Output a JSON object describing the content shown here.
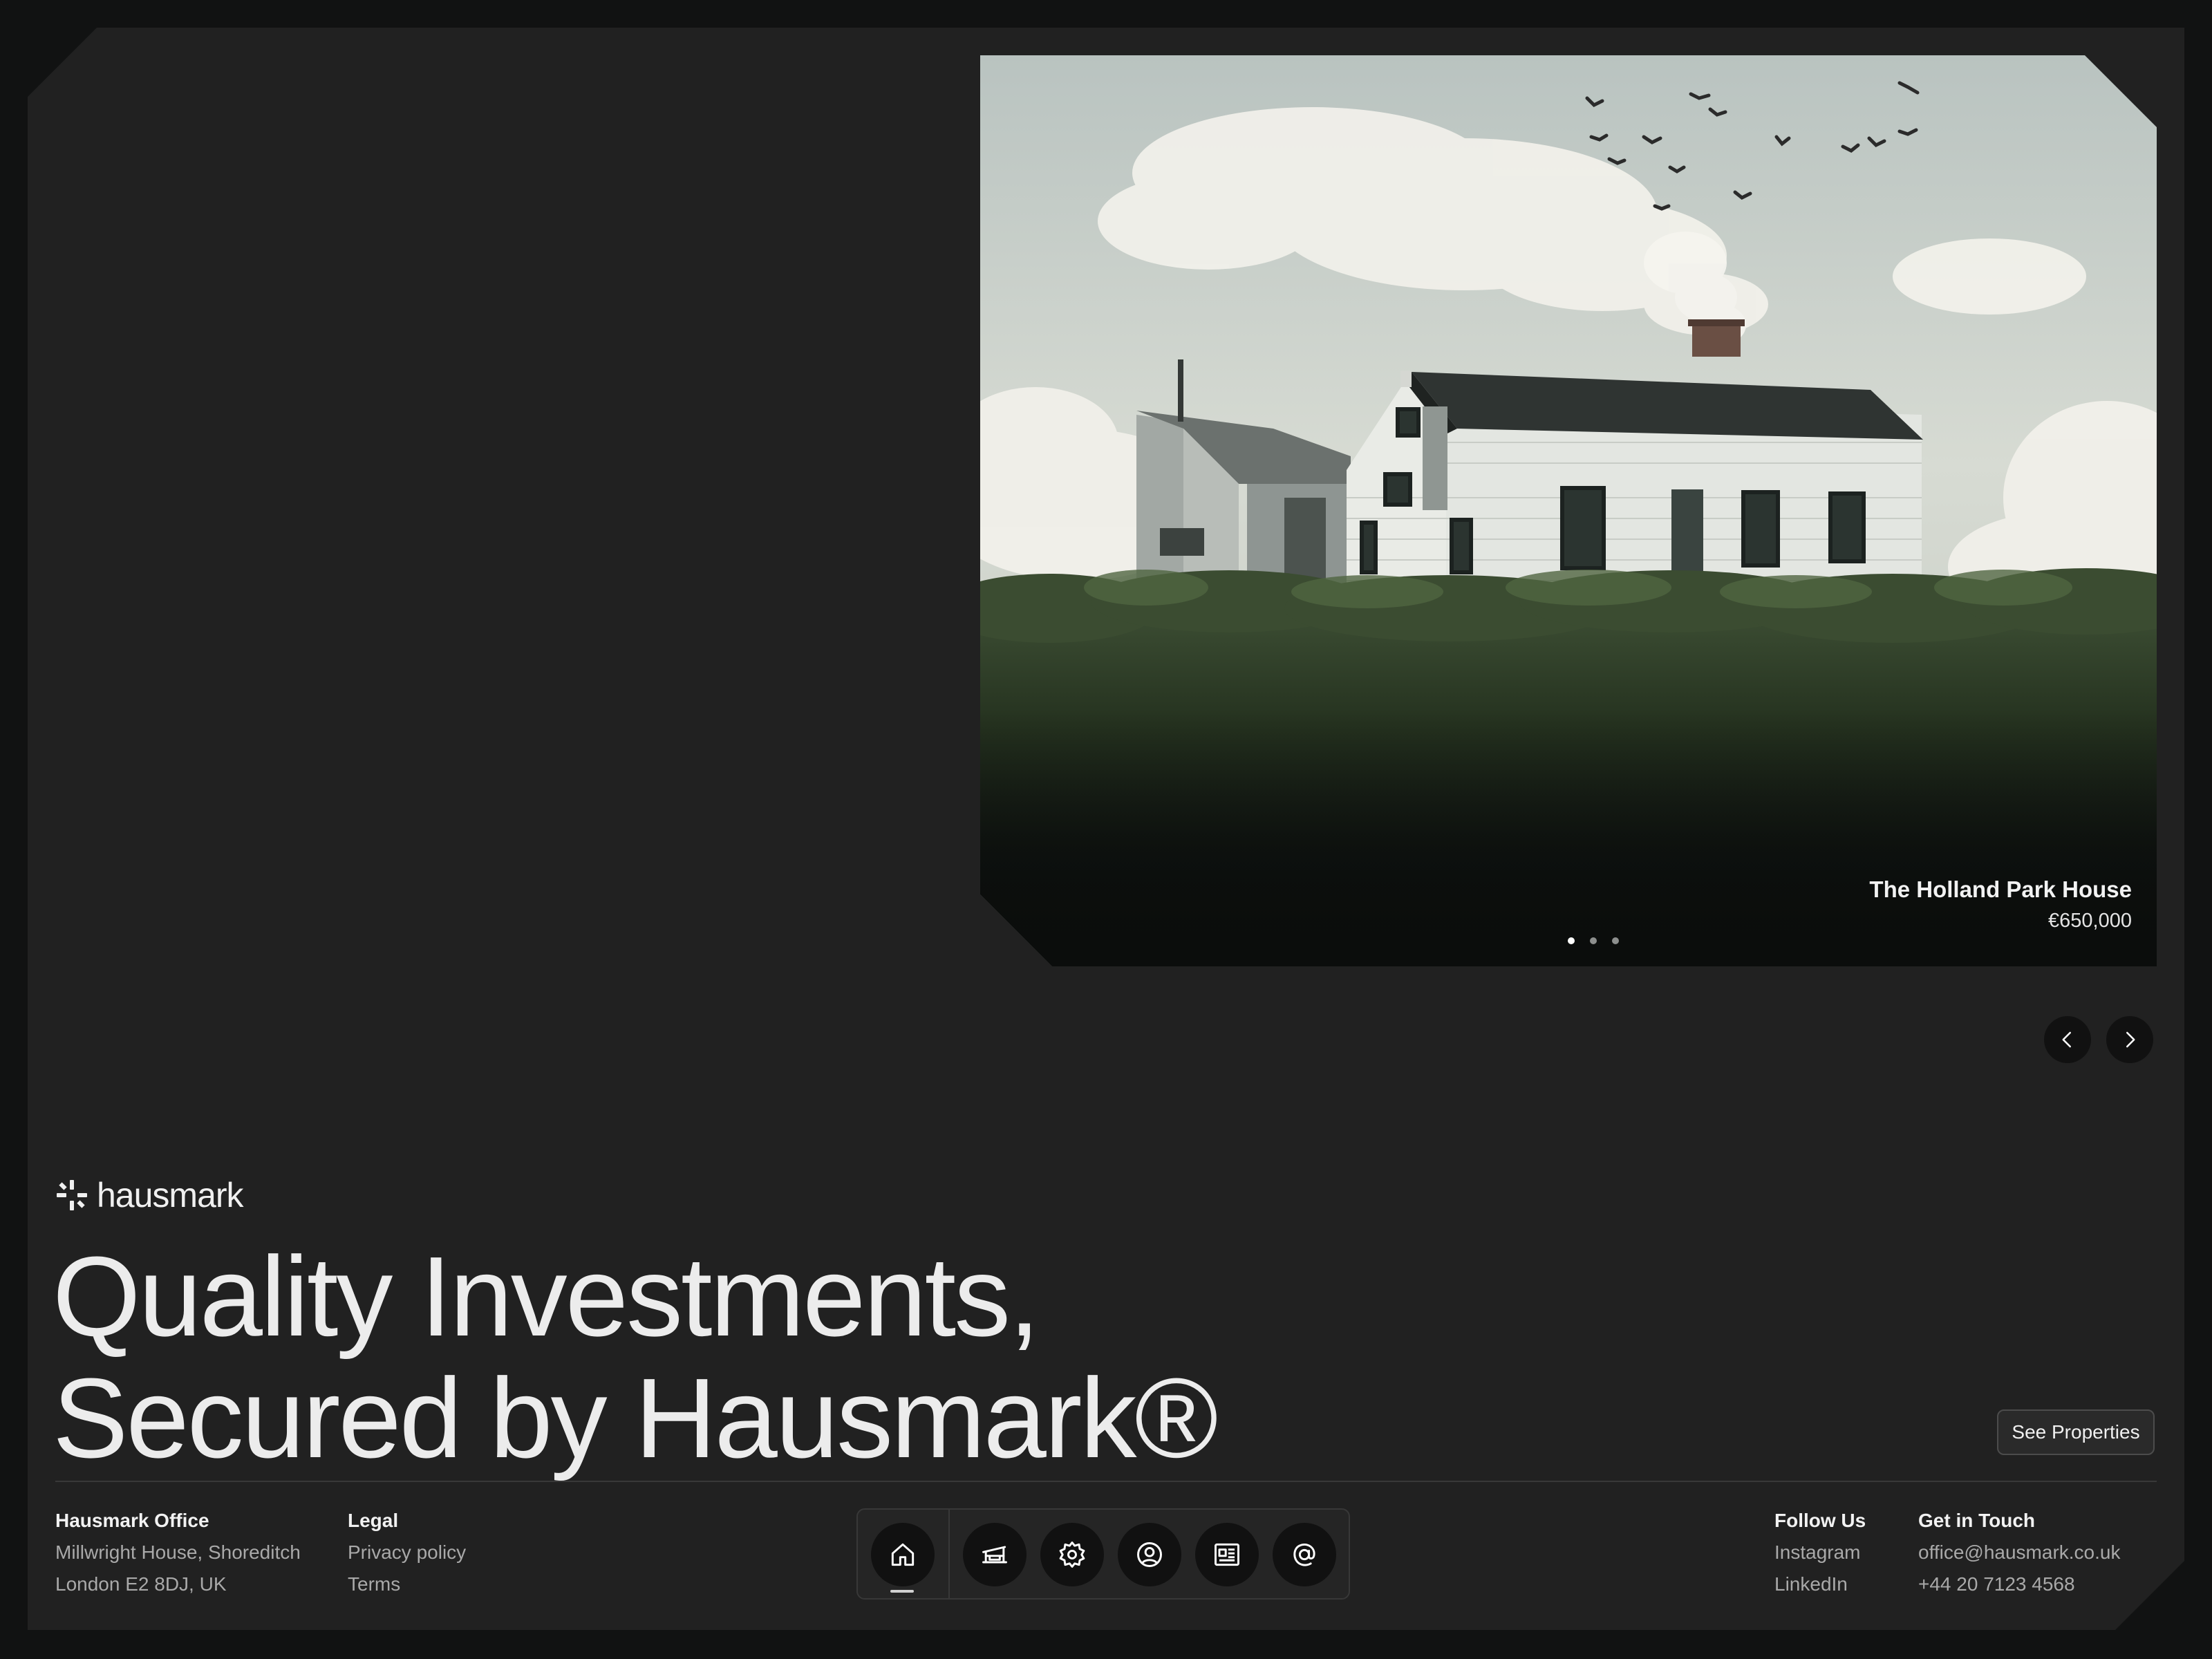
{
  "brand": {
    "name": "hausmark",
    "logo_icon": "asterisk-cross-logo"
  },
  "hero": {
    "property_name": "The Holland Park House",
    "price": "€650,000",
    "slides_total": 3,
    "active_slide": 1
  },
  "headline": {
    "line1": "Quality Investments,",
    "line2": "Secured by Hausmark®"
  },
  "cta": {
    "see_properties": "See Properties"
  },
  "footer": {
    "office": {
      "heading": "Hausmark Office",
      "line1": "Millwright House, Shoreditch",
      "line2": "London E2 8DJ, UK"
    },
    "legal": {
      "heading": "Legal",
      "privacy": "Privacy policy",
      "terms": "Terms"
    },
    "follow": {
      "heading": "Follow Us",
      "instagram": "Instagram",
      "linkedin": "LinkedIn"
    },
    "contact": {
      "heading": "Get in Touch",
      "email": "office@hausmark.co.uk",
      "phone": "+44 20 7123 4568"
    }
  },
  "dock": {
    "items": [
      "home-icon",
      "sofa-icon",
      "gear-icon",
      "user-circle-icon",
      "newspaper-icon",
      "at-sign-icon"
    ],
    "active": "home-icon"
  },
  "colors": {
    "background": "#111212",
    "panel": "#212121",
    "text": "#ececec",
    "muted": "#a9a9a9"
  }
}
